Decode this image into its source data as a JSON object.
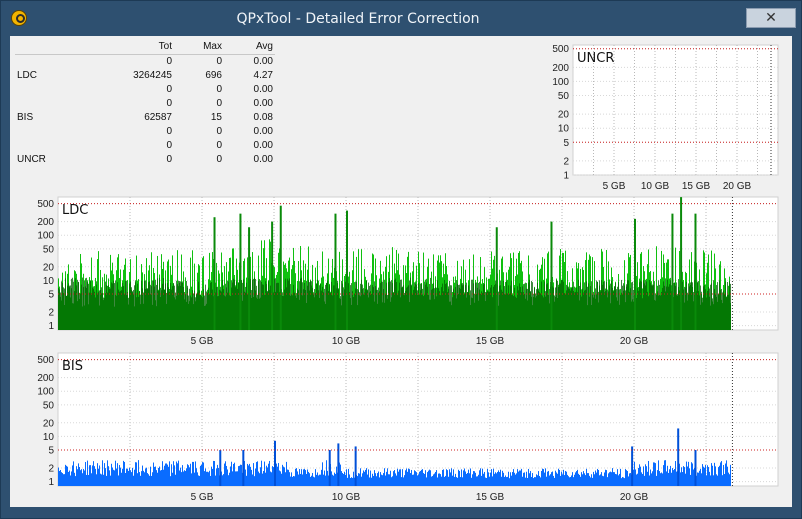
{
  "window": {
    "title": "QPxTool - Detailed Error Correction",
    "close_glyph": "✕",
    "icon": "qpxtool-app-icon"
  },
  "stats": {
    "headers": {
      "label": "",
      "tot": "Tot",
      "max": "Max",
      "avg": "Avg"
    },
    "rows": [
      {
        "label": "",
        "tot": "0",
        "max": "0",
        "avg": "0.00"
      },
      {
        "label": "LDC",
        "tot": "3264245",
        "max": "696",
        "avg": "4.27"
      },
      {
        "label": "",
        "tot": "0",
        "max": "0",
        "avg": "0.00"
      },
      {
        "label": "",
        "tot": "0",
        "max": "0",
        "avg": "0.00"
      },
      {
        "label": "BIS",
        "tot": "62587",
        "max": "15",
        "avg": "0.08"
      },
      {
        "label": "",
        "tot": "0",
        "max": "0",
        "avg": "0.00"
      },
      {
        "label": "",
        "tot": "0",
        "max": "0",
        "avg": "0.00"
      },
      {
        "label": "UNCR",
        "tot": "0",
        "max": "0",
        "avg": "0.00"
      }
    ]
  },
  "chart_data": [
    {
      "id": "uncr",
      "type": "bar",
      "title": "UNCR",
      "yscale": "log",
      "ylim": [
        1,
        600
      ],
      "yticks": [
        "500",
        "200",
        "100",
        "50",
        "20",
        "10",
        "5",
        "2",
        "1"
      ],
      "xlim": [
        0,
        25
      ],
      "xticks": [
        "5 GB",
        "10 GB",
        "15 GB",
        "20 GB"
      ],
      "reference_lines": [
        500,
        5
      ],
      "series": [
        {
          "values": [],
          "color": "#00cc00"
        }
      ]
    },
    {
      "id": "ldc",
      "type": "bar",
      "title": "LDC",
      "yscale": "log",
      "ylim": [
        0.8,
        700
      ],
      "yticks": [
        "500",
        "200",
        "100",
        "50",
        "20",
        "10",
        "5",
        "2",
        "1"
      ],
      "xlim": [
        0,
        25
      ],
      "xticks": [
        "5 GB",
        "10 GB",
        "15 GB",
        "20 GB"
      ],
      "data_end_gb": 23.4,
      "reference_lines": [
        500,
        5
      ],
      "series": [
        {
          "name": "",
          "color": "#10c010",
          "x": [
            0.5,
            1.5,
            2.5,
            3.5,
            4.5,
            5.5,
            6.5,
            7.5,
            8.5,
            9.5,
            10.5,
            11.5,
            12.5,
            13.5,
            14.5,
            15.5,
            16.5,
            17.5,
            18.5,
            19.5,
            20.5,
            21.5,
            22.5
          ],
          "values": [
            40,
            45,
            42,
            50,
            48,
            44,
            60,
            90,
            70,
            55,
            52,
            58,
            60,
            55,
            50,
            48,
            52,
            55,
            50,
            52,
            60,
            80,
            50
          ]
        },
        {
          "name": "",
          "color": "#006000",
          "x": [
            0.5,
            1.5,
            2.5,
            3.5,
            4.5,
            5.5,
            6.5,
            7.5,
            8.5,
            9.5,
            10.5,
            11.5,
            12.5,
            13.5,
            14.5,
            15.5,
            16.5,
            17.5,
            18.5,
            19.5,
            20.5,
            21.5,
            22.5
          ],
          "values": [
            9,
            8,
            8,
            9,
            8,
            8,
            9,
            9,
            9,
            8,
            8,
            9,
            9,
            8,
            8,
            8,
            8,
            8,
            8,
            8,
            8,
            9,
            8
          ]
        }
      ],
      "spikes": [
        {
          "x": 5.4,
          "value": 250
        },
        {
          "x": 6.3,
          "value": 300
        },
        {
          "x": 6.6,
          "value": 150
        },
        {
          "x": 7.4,
          "value": 200
        },
        {
          "x": 7.7,
          "value": 450
        },
        {
          "x": 9.6,
          "value": 300
        },
        {
          "x": 10.0,
          "value": 350
        },
        {
          "x": 15.2,
          "value": 150
        },
        {
          "x": 17.1,
          "value": 200
        },
        {
          "x": 20.0,
          "value": 230
        },
        {
          "x": 21.3,
          "value": 300
        },
        {
          "x": 21.6,
          "value": 696
        },
        {
          "x": 22.1,
          "value": 300
        }
      ]
    },
    {
      "id": "bis",
      "type": "bar",
      "title": "BIS",
      "yscale": "log",
      "ylim": [
        0.8,
        700
      ],
      "yticks": [
        "500",
        "200",
        "100",
        "50",
        "20",
        "10",
        "5",
        "2",
        "1"
      ],
      "xlim": [
        0,
        25
      ],
      "xticks": [
        "5 GB",
        "10 GB",
        "15 GB",
        "20 GB"
      ],
      "data_end_gb": 23.4,
      "reference_lines": [
        500,
        5
      ],
      "series": [
        {
          "name": "",
          "color": "#0a6cff",
          "x": [
            0.5,
            1.5,
            2.5,
            3.5,
            4.5,
            5.5,
            6.5,
            7.5,
            8.5,
            9.5,
            10.5,
            11.5,
            12.5,
            13.5,
            14.5,
            15.5,
            16.5,
            17.5,
            18.5,
            19.5,
            20.5,
            21.5,
            22.5
          ],
          "values": [
            3,
            3,
            3,
            3,
            3,
            3,
            3,
            3,
            2,
            3,
            2,
            2,
            2,
            2,
            2,
            2,
            2,
            2,
            2,
            2,
            3,
            3,
            3
          ]
        }
      ],
      "spikes": [
        {
          "x": 5.6,
          "value": 5
        },
        {
          "x": 6.4,
          "value": 5
        },
        {
          "x": 7.5,
          "value": 8
        },
        {
          "x": 9.4,
          "value": 5
        },
        {
          "x": 9.7,
          "value": 7
        },
        {
          "x": 10.3,
          "value": 6
        },
        {
          "x": 19.9,
          "value": 6
        },
        {
          "x": 21.5,
          "value": 15
        },
        {
          "x": 22.1,
          "value": 5
        }
      ]
    }
  ]
}
